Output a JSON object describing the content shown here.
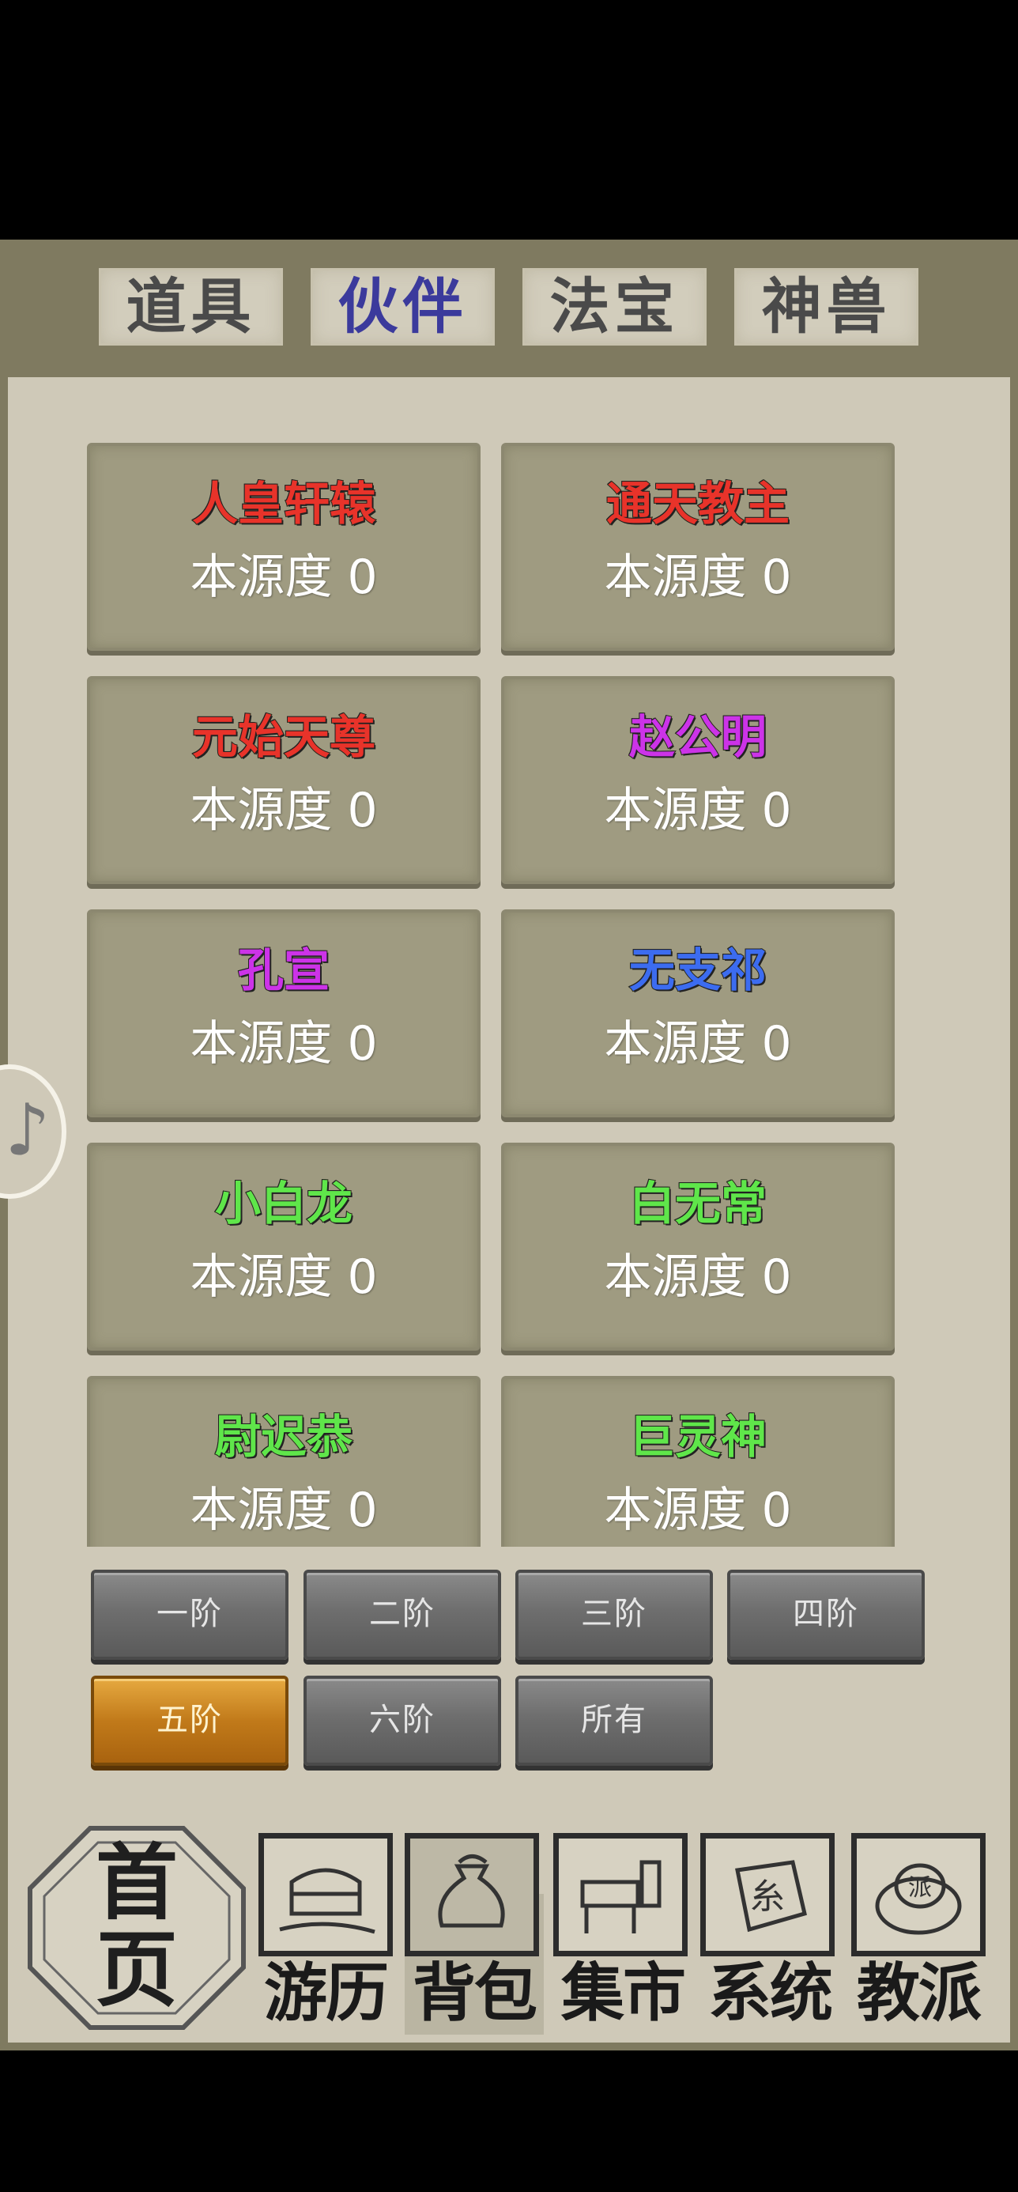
{
  "tabs": [
    {
      "label": "道具",
      "active": false
    },
    {
      "label": "伙伴",
      "active": true
    },
    {
      "label": "法宝",
      "active": false
    },
    {
      "label": "神兽",
      "active": false
    }
  ],
  "companions": [
    {
      "name": "人皇轩辕",
      "color": "#e8332a",
      "stat_label": "本源度",
      "stat_value": "0"
    },
    {
      "name": "通天教主",
      "color": "#e8332a",
      "stat_label": "本源度",
      "stat_value": "0"
    },
    {
      "name": "元始天尊",
      "color": "#e8332a",
      "stat_label": "本源度",
      "stat_value": "0"
    },
    {
      "name": "赵公明",
      "color": "#cc33e8",
      "stat_label": "本源度",
      "stat_value": "0"
    },
    {
      "name": "孔宣",
      "color": "#cc33e8",
      "stat_label": "本源度",
      "stat_value": "0"
    },
    {
      "name": "无支祁",
      "color": "#3c6cf0",
      "stat_label": "本源度",
      "stat_value": "0"
    },
    {
      "name": "小白龙",
      "color": "#5fe64a",
      "stat_label": "本源度",
      "stat_value": "0"
    },
    {
      "name": "白无常",
      "color": "#5fe64a",
      "stat_label": "本源度",
      "stat_value": "0"
    },
    {
      "name": "尉迟恭",
      "color": "#5fe64a",
      "stat_label": "本源度",
      "stat_value": "0"
    },
    {
      "name": "巨灵神",
      "color": "#5fe64a",
      "stat_label": "本源度",
      "stat_value": "0"
    }
  ],
  "tiers": [
    {
      "label": "一阶",
      "active": false
    },
    {
      "label": "二阶",
      "active": false
    },
    {
      "label": "三阶",
      "active": false
    },
    {
      "label": "四阶",
      "active": false
    },
    {
      "label": "五阶",
      "active": true
    },
    {
      "label": "六阶",
      "active": false
    },
    {
      "label": "所有",
      "active": false
    }
  ],
  "home": {
    "line1": "首",
    "line2": "页"
  },
  "nav": [
    {
      "label": "游历",
      "icon": "chest-icon"
    },
    {
      "label": "背包",
      "icon": "bag-icon"
    },
    {
      "label": "集市",
      "icon": "market-stall-icon"
    },
    {
      "label": "系统",
      "icon": "system-seal-icon"
    },
    {
      "label": "教派",
      "icon": "sect-bowl-icon"
    }
  ]
}
